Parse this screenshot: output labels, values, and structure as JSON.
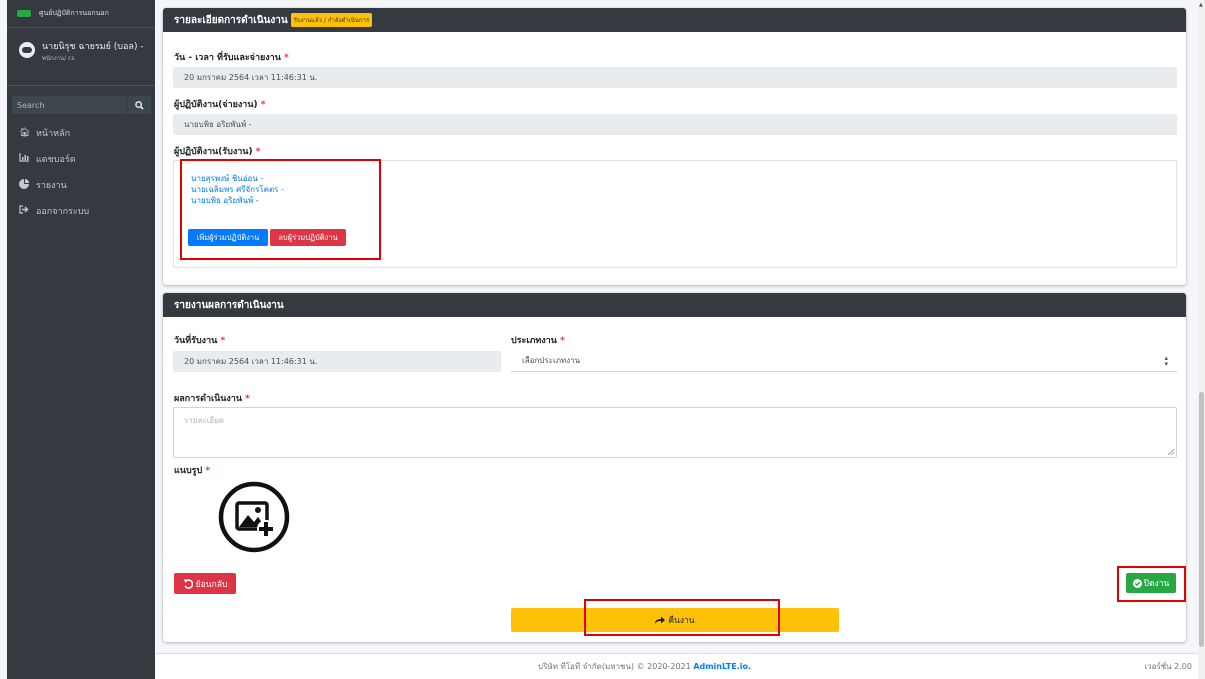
{
  "brand": {
    "title": "ศูนย์ปฏิบัติการนอกนอก"
  },
  "user": {
    "name": "นายนิรุช ฉายรมย์ (บอล) -",
    "role": "พนักงาน/ cs"
  },
  "search": {
    "placeholder": "Search"
  },
  "nav": {
    "items": [
      {
        "label": "หน้าหลัก",
        "icon": "home-icon"
      },
      {
        "label": "แดชบอร์ด",
        "icon": "chart-icon"
      },
      {
        "label": "รายงาน",
        "icon": "pie-icon"
      },
      {
        "label": "ออกจากระบบ",
        "icon": "logout-icon"
      }
    ]
  },
  "details": {
    "header": "รายละเอียดการดำเนินงาน",
    "status_badge": "รับงานแล้ว / กำลังดำเนินการ",
    "datetime_label": "วัน - เวลา ที่รับและจ่ายงาน",
    "datetime_value": "20 มกราคม 2564 เวลา 11:46:31 น.",
    "assigner_label": "ผู้ปฏิบัติงาน(จ่ายงาน)",
    "assigner_value": "นายบพิธ อริยพันพ์ -",
    "receivers_label": "ผู้ปฏิบัติงาน(รับงาน)",
    "receivers": [
      "นายสุรพงษ์ ชินอ่อน -",
      "นายเฉลิมพร ศรีจักรโคตร -",
      "นายบพิธ อริยพันพ์ -"
    ],
    "add_button": "เพิ่มผู้ร่วมปฏิบัติงาน",
    "remove_button": "ลบผู้ร่วมปฏิบัติงาน",
    "required_mark": "*"
  },
  "report": {
    "header": "รายงานผลการดำเนินงาน",
    "date_label": "วันที่รับงาน",
    "date_value": "20 มกราคม 2564 เวลา 11:46:31 น.",
    "type_label": "ประเภทงาน",
    "type_value": "เลือกประเภทงาน",
    "result_label": "ผลการดำเนินงาน",
    "result_placeholder": "รายละเอียด",
    "attach_label": "แนบรูป",
    "back_button": "ย้อนกลับ",
    "close_button": "ปิดงาน",
    "return_button": "คืนงาน"
  },
  "footer": {
    "copyright": "บริษัท ทีโอที จำกัด(มหาชน) © 2020-2021",
    "link": "AdminLTE.io.",
    "version": "เวอร์ชั่น 2.00"
  },
  "colors": {
    "primary": "#007bff",
    "danger": "#dc3545",
    "success": "#28a745",
    "warning": "#ffc107",
    "dark": "#343a40",
    "highlight": "#e00000"
  }
}
